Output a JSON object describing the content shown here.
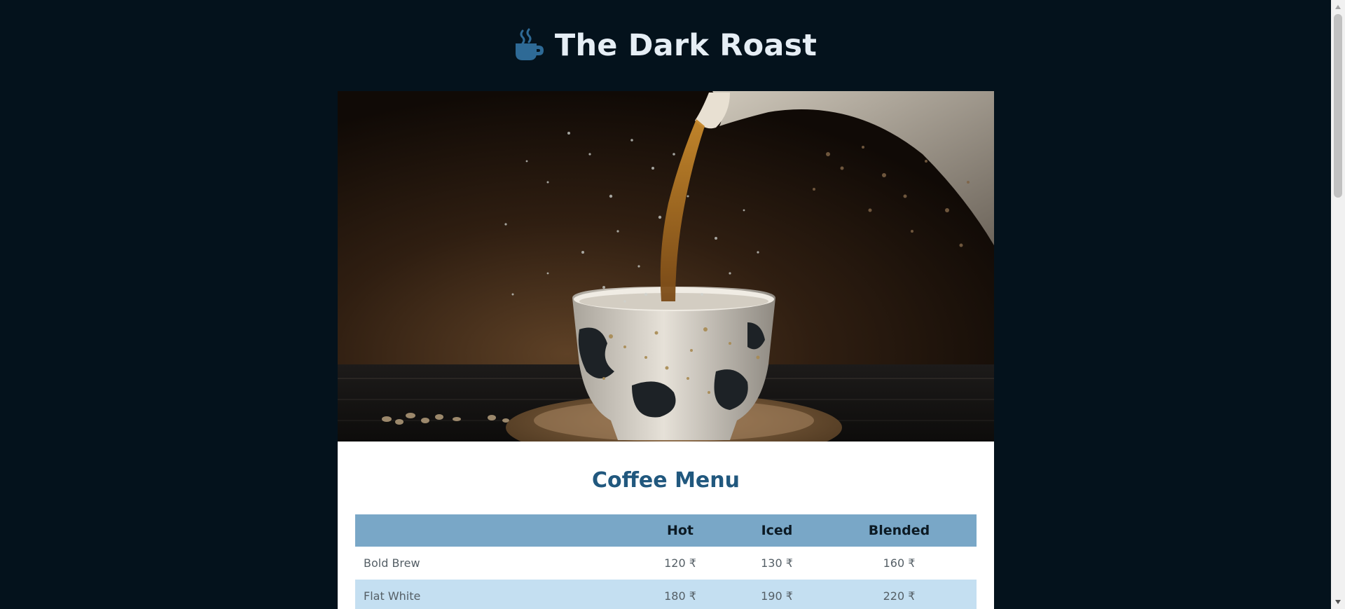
{
  "header": {
    "icon": "coffee-cup-icon",
    "title": "The Dark Roast"
  },
  "hero": {
    "icon": "coffee-pour-image"
  },
  "menu": {
    "title": "Coffee Menu",
    "columns": [
      "",
      "Hot",
      "Iced",
      "Blended"
    ],
    "rows": [
      {
        "name": "Bold Brew",
        "hot": "120 ₹",
        "iced": "130 ₹",
        "blended": "160 ₹"
      },
      {
        "name": "Flat White",
        "hot": "180 ₹",
        "iced": "190 ₹",
        "blended": "220 ₹"
      }
    ]
  },
  "colors": {
    "page_background": "#04121c",
    "title_text": "#e6eef5",
    "accent": "#21587e",
    "table_header": "#79a7c7",
    "table_alt_row": "#c4dff1"
  }
}
